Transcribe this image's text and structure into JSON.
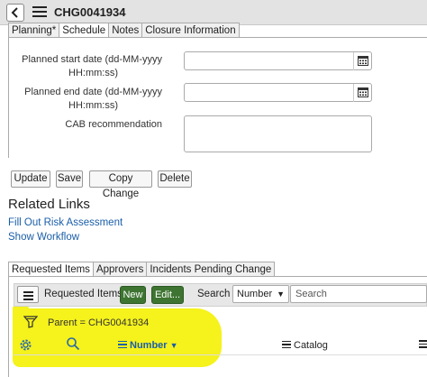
{
  "header": {
    "record_number": "CHG0041934"
  },
  "form_tabs": [
    "Planning*",
    "Schedule",
    "Notes",
    "Closure Information"
  ],
  "schedule": {
    "planned_start_label_line1": "Planned start date (dd-MM-yyyy",
    "planned_start_label_line2": "HH:mm:ss)",
    "planned_start_value": "",
    "planned_end_label_line1": "Planned end date (dd-MM-yyyy",
    "planned_end_label_line2": "HH:mm:ss)",
    "planned_end_value": "",
    "cab_label": "CAB recommendation",
    "cab_value": ""
  },
  "actions": {
    "update": "Update",
    "save": "Save",
    "copy_change": "Copy Change",
    "delete": "Delete"
  },
  "related_links": {
    "title": "Related Links",
    "fill_out_risk": "Fill Out Risk Assessment",
    "show_workflow": "Show Workflow"
  },
  "related_tabs": [
    "Requested Items",
    "Approvers",
    "Incidents Pending Change"
  ],
  "related_list": {
    "title": "Requested Items",
    "new_label": "New",
    "edit_label": "Edit...",
    "search_label": "Search",
    "search_field_selected": "Number",
    "search_placeholder": "Search",
    "filter_breadcrumb": "Parent = CHG0041934",
    "columns": [
      "Number",
      "Catalog"
    ]
  },
  "icons": {
    "back": "chevron-left-icon",
    "menu": "hamburger-icon",
    "calendar": "calendar-icon",
    "filter": "funnel-icon",
    "gear": "gear-icon",
    "search": "magnifier-icon"
  },
  "colors": {
    "link_blue": "#1a5ea8",
    "button_green": "#3d7431",
    "highlight_yellow": "#f5f21c",
    "header_gray": "#e3e3e3"
  }
}
